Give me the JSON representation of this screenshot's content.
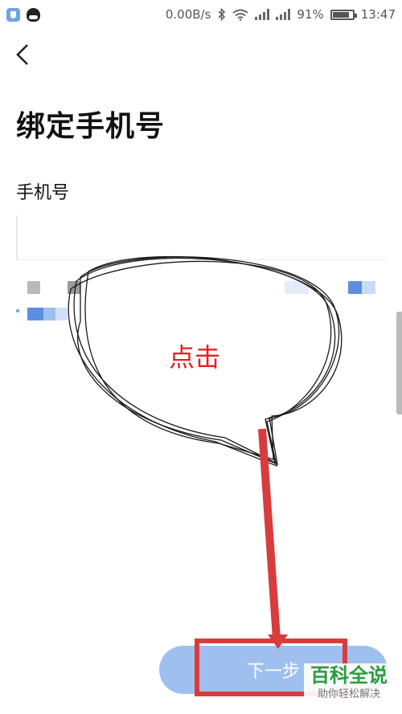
{
  "status_bar": {
    "net_speed": "0.00B/s",
    "battery": "91%",
    "battery_level": 0.91,
    "time": "13:47"
  },
  "page": {
    "title": "绑定手机号",
    "phone_label": "手机号",
    "phone_value": "",
    "next_label": "下一步"
  },
  "annotation": {
    "callout_text": "点击"
  },
  "watermark": {
    "main": "百科全说",
    "sub": "助你轻松解决"
  },
  "colors": {
    "accent": "#9fc0ef",
    "annotation_red": "#d83c3c",
    "callout_text": "#e5201d",
    "watermark_green": "#2a9c3c"
  },
  "icons": [
    "shield-icon",
    "qq-icon",
    "bluetooth-icon",
    "wifi-icon",
    "signal-icon",
    "battery-icon",
    "back-arrow-icon"
  ]
}
